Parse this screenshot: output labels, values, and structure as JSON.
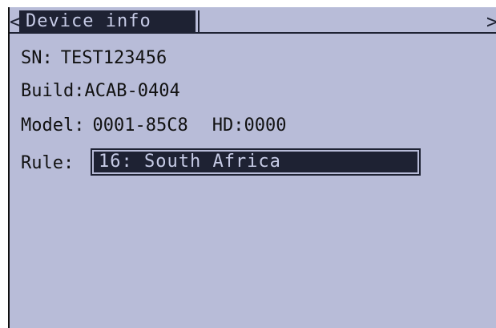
{
  "header": {
    "prev_arrow": "<",
    "title": "Device info",
    "next_arrow": ">"
  },
  "info": {
    "sn_label": "SN:",
    "sn_value": "TEST123456",
    "build_label": "Build:",
    "build_value": "ACAB-0404",
    "model_label": "Model:",
    "model_value": "0001-85C8",
    "hd_label": "HD:",
    "hd_value": "0000",
    "rule_label": "Rule:",
    "rule_value": "16: South Africa"
  },
  "colors": {
    "screen_background": "#b8bcd8",
    "highlight_background": "#1e2233",
    "highlight_text": "#c6cbe6",
    "text": "#111111"
  }
}
